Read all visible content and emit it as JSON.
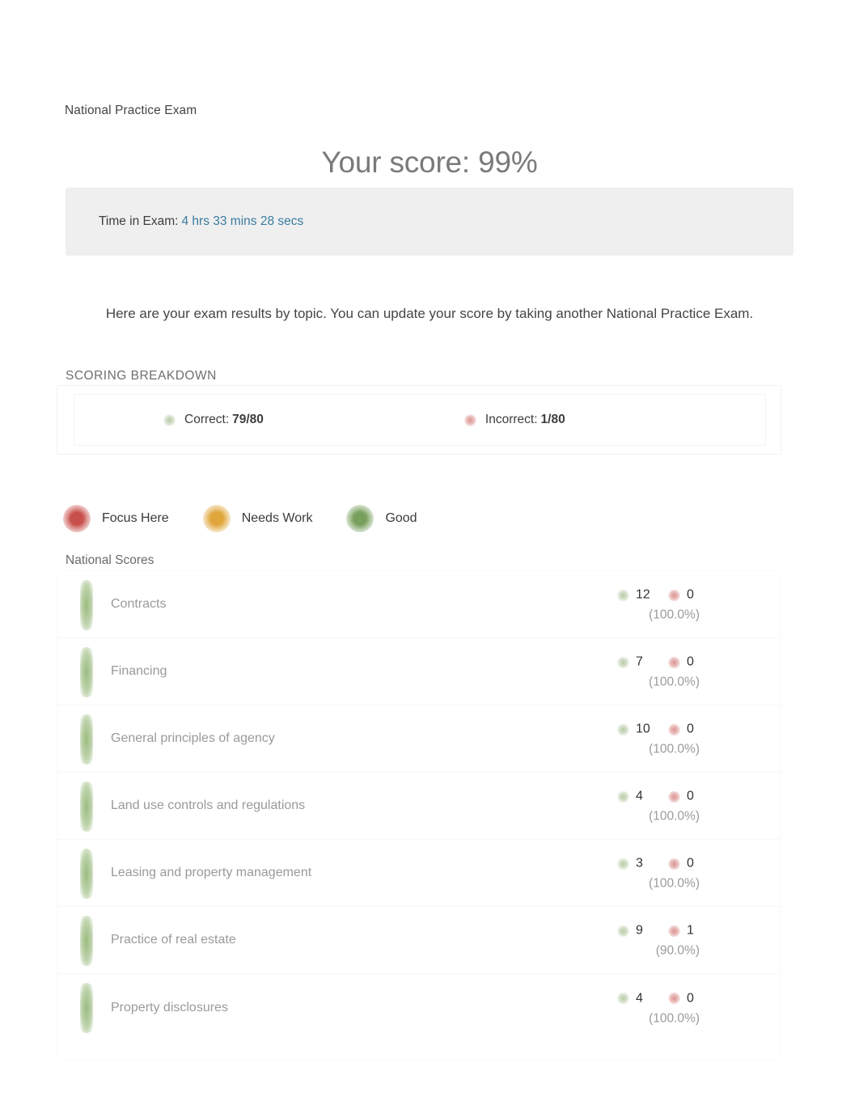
{
  "header": {
    "exam_name": "National Practice Exam",
    "score_heading": "Your score: 99%"
  },
  "time_box": {
    "label": "Time in Exam:",
    "value": "4 hrs 33 mins 28 secs",
    "value_color": "#3a7ca0"
  },
  "intro": {
    "text": "Here are your exam results by topic. You can update your score by taking another National Practice Exam."
  },
  "breakdown": {
    "title": "SCORING BREAKDOWN",
    "correct_label": "Correct:",
    "correct_value": "79/80",
    "incorrect_label": "Incorrect:",
    "incorrect_value": "1/80"
  },
  "legend": {
    "items": [
      {
        "label": "Focus Here",
        "color": "#c8504c",
        "icon": "status-dot-red"
      },
      {
        "label": "Needs Work",
        "color": "#e0a63b",
        "icon": "status-dot-amber"
      },
      {
        "label": "Good",
        "color": "#77a05c",
        "icon": "status-dot-green"
      }
    ]
  },
  "scores": {
    "section_title": "National Scores",
    "rows": [
      {
        "topic": "Contracts",
        "correct": "12",
        "incorrect": "0",
        "percent": "(100.0%)",
        "status": "good"
      },
      {
        "topic": "Financing",
        "correct": "7",
        "incorrect": "0",
        "percent": "(100.0%)",
        "status": "good"
      },
      {
        "topic": "General principles of agency",
        "correct": "10",
        "incorrect": "0",
        "percent": "(100.0%)",
        "status": "good"
      },
      {
        "topic": "Land use controls and regulations",
        "correct": "4",
        "incorrect": "0",
        "percent": "(100.0%)",
        "status": "good"
      },
      {
        "topic": "Leasing and property management",
        "correct": "3",
        "incorrect": "0",
        "percent": "(100.0%)",
        "status": "good"
      },
      {
        "topic": "Practice of real estate",
        "correct": "9",
        "incorrect": "1",
        "percent": "(90.0%)",
        "status": "good"
      },
      {
        "topic": "Property disclosures",
        "correct": "4",
        "incorrect": "0",
        "percent": "(100.0%)",
        "status": "good"
      }
    ]
  },
  "chart_data": {
    "type": "bar",
    "title": "National Scores",
    "categories": [
      "Contracts",
      "Financing",
      "General principles of agency",
      "Land use controls and regulations",
      "Leasing and property management",
      "Practice of real estate",
      "Property disclosures"
    ],
    "series": [
      {
        "name": "Correct",
        "values": [
          12,
          7,
          10,
          4,
          3,
          9,
          4
        ]
      },
      {
        "name": "Incorrect",
        "values": [
          0,
          0,
          0,
          0,
          0,
          1,
          0
        ]
      },
      {
        "name": "Percent",
        "values": [
          100.0,
          100.0,
          100.0,
          100.0,
          100.0,
          90.0,
          100.0
        ]
      }
    ],
    "xlabel": "",
    "ylabel": "",
    "ylim": [
      0,
      100
    ],
    "legend_position": "top",
    "grid": false,
    "total_correct": 79,
    "total_questions": 80,
    "overall_percent": 99
  }
}
